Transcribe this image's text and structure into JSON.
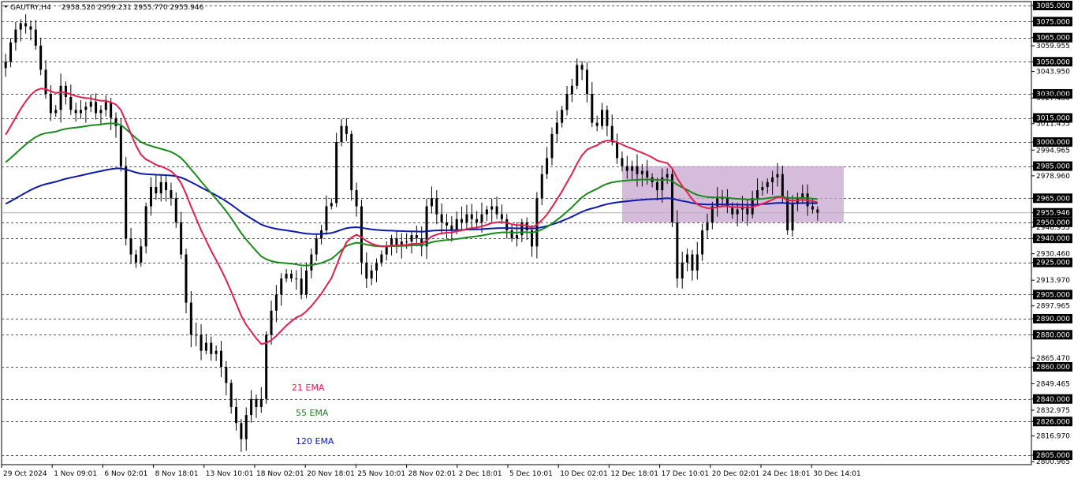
{
  "header": {
    "symbol": "GAUTRY,H4",
    "ohlc": "2958.520 2959.231 2955.770 2955.946"
  },
  "current_price_label": "2955.946",
  "colors": {
    "ema21": "#e0204f",
    "ema55": "#1a8a1a",
    "ema120": "#0b1aa8",
    "zone": "#c7a6cf",
    "label_bg": "#000000",
    "candle": "#000000"
  },
  "chart_data": {
    "type": "candlestick",
    "title": "",
    "ylim": [
      2805,
      3085
    ],
    "y_axis_labels": [
      "3085.000",
      "3075.000",
      "3065.000",
      "3059.955",
      "3050.000",
      "3043.950",
      "3030.000",
      "3027.480",
      "3015.000",
      "3011.455",
      "3000.000",
      "2994.965",
      "2985.000",
      "2978.960",
      "2965.000",
      "2955.946",
      "2950.000",
      "2946.935",
      "2940.000",
      "2930.460",
      "2925.000",
      "2913.970",
      "2905.000",
      "2897.965",
      "2890.000",
      "2880.000",
      "2865.470",
      "2860.000",
      "2849.465",
      "2840.000",
      "2832.975",
      "2826.000",
      "2816.970",
      "2805.000",
      "2800.965"
    ],
    "horizontal_levels": [
      "3085.000",
      "3075.000",
      "3065.000",
      "3050.000",
      "3030.000",
      "3015.000",
      "3000.000",
      "2985.000",
      "2965.000",
      "2950.000",
      "2940.000",
      "2925.000",
      "2905.000",
      "2890.000",
      "2880.000",
      "2860.000",
      "2840.000",
      "2826.000",
      "2805.000"
    ],
    "x_tick_labels": [
      "29 Oct 2024",
      "1 Nov 09:01",
      "6 Nov 02:01",
      "8 Nov 18:01",
      "13 Nov 10:01",
      "18 Nov 02:01",
      "20 Nov 18:01",
      "25 Nov 10:01",
      "28 Nov 02:01",
      "2 Dec 18:01",
      "5 Dec 10:01",
      "10 Dec 02:01",
      "12 Dec 18:01",
      "17 Dec 10:01",
      "20 Dec 02:01",
      "24 Dec 18:01",
      "30 Dec 14:01"
    ],
    "zone": {
      "low": 2950,
      "high": 2985,
      "from": "12 Dec 18:01",
      "to": "30 Dec 14:01"
    },
    "legend": [
      {
        "name": "21 EMA",
        "color": "#e0204f"
      },
      {
        "name": "55 EMA",
        "color": "#1a8a1a"
      },
      {
        "name": "120 EMA",
        "color": "#0b1aa8"
      }
    ],
    "close": [
      3050,
      3062,
      3070,
      3074,
      3072,
      3070,
      3060,
      3045,
      3030,
      3018,
      3020,
      3035,
      3028,
      3020,
      3018,
      3020,
      3022,
      3025,
      3018,
      3020,
      3025,
      3015,
      3010,
      2985,
      2940,
      2930,
      2925,
      2935,
      2960,
      2972,
      2968,
      2975,
      2970,
      2965,
      2950,
      2930,
      2900,
      2880,
      2880,
      2870,
      2875,
      2868,
      2870,
      2860,
      2850,
      2835,
      2825,
      2815,
      2830,
      2840,
      2835,
      2840,
      2880,
      2895,
      2905,
      2915,
      2918,
      2915,
      2915,
      2905,
      2920,
      2930,
      2940,
      2945,
      2960,
      2962,
      3000,
      3010,
      3005,
      2970,
      2960,
      2925,
      2915,
      2920,
      2925,
      2930,
      2935,
      2940,
      2935,
      2938,
      2938,
      2942,
      2940,
      2935,
      2960,
      2965,
      2955,
      2950,
      2948,
      2945,
      2952,
      2950,
      2955,
      2952,
      2950,
      2955,
      2958,
      2960,
      2955,
      2952,
      2945,
      2940,
      2942,
      2950,
      2945,
      2935,
      2965,
      2980,
      2990,
      3005,
      3012,
      3020,
      3030,
      3035,
      3048,
      3045,
      3030,
      3012,
      3010,
      3020,
      3010,
      3000,
      2990,
      2985,
      2982,
      2985,
      2980,
      2982,
      2978,
      2975,
      2970,
      2978,
      2980,
      2950,
      2915,
      2925,
      2930,
      2920,
      2930,
      2945,
      2950,
      2960,
      2965,
      2965,
      2960,
      2955,
      2958,
      2960,
      2955,
      2965,
      2970,
      2972,
      2975,
      2978,
      2980,
      2965,
      2945,
      2962,
      2965,
      2968,
      2960,
      2958,
      2956
    ]
  }
}
